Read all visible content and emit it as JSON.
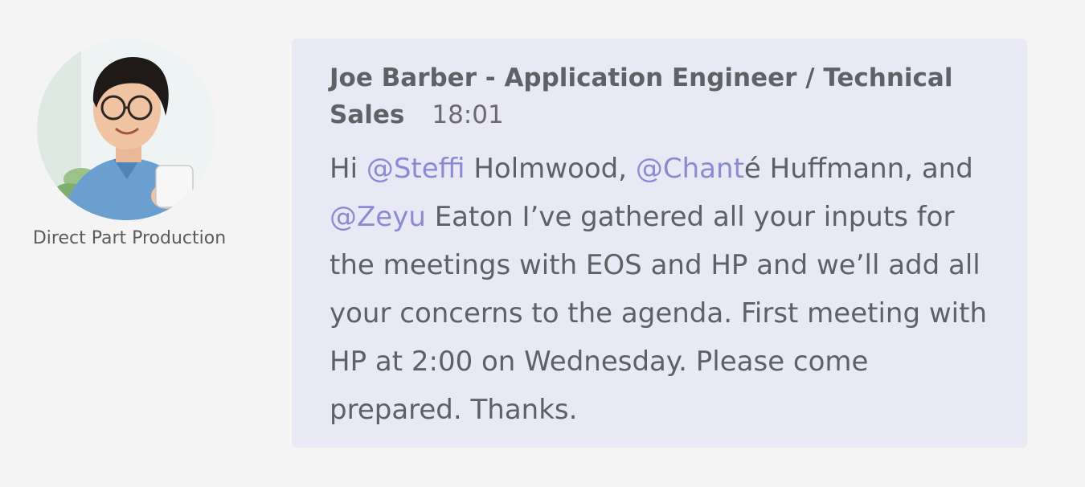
{
  "author": {
    "avatar_icon": "person-photo",
    "caption": "Direct Part Production"
  },
  "message": {
    "sender": "Joe Barber - Application Engineer / Technical Sales",
    "timestamp": "18:01",
    "body": {
      "t1": "Hi ",
      "m1": "@Steffi",
      "t2": " Holmwood, ",
      "m2": "@Chant",
      "t3": "é Huffmann, and ",
      "m3": "@Zeyu",
      "t4": " Eaton I’ve gathered all your inputs for the meetings with EOS and HP and we’ll add all your concerns to the agenda. First meeting with HP at 2:00 on Wednesday. Please come prepared. Thanks."
    }
  },
  "colors": {
    "page_background": "#f4f4f4",
    "bubble_background": "#e9e9f5",
    "mention": "#8b8bd3",
    "text": "#5f5f66"
  }
}
